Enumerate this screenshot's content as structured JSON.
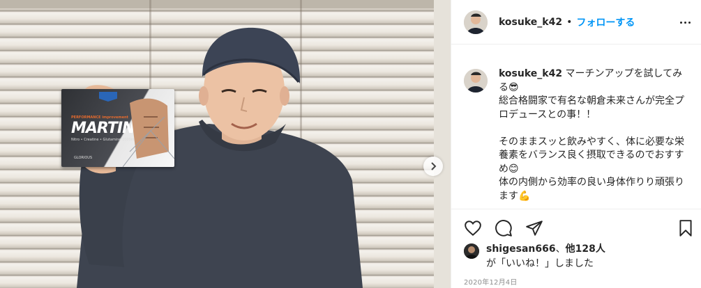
{
  "post": {
    "username": "kosuke_k42",
    "follow_label": "フォローする",
    "separator": "•",
    "caption_username": "kosuke_k42",
    "caption_text": " マーチンアップを試してみる😎\n総合格闘家で有名な朝倉未来さんが完全プロデュースとの事！！\n\nそのままスッと飲みやすく、体に必要な栄養素をバランス良く摂取できるのでおすすめ😊\n体の内側から効率の良い身体作りり頑張ります💪",
    "liked_by_user": "shigesan666",
    "liked_by_sep": "、",
    "liked_by_others": "他128人",
    "liked_by_suffix": "が「いいね！」しました",
    "date": "2020年12月4日"
  },
  "product": {
    "logo": "MARTIN-UP",
    "tagline": "PERFORMANCE improvement",
    "desc": "Nitro • Creatine • Glutamine 2000mg",
    "brand": "GLORIOUS"
  },
  "icons": {
    "like": "heart-icon",
    "comment": "comment-icon",
    "share": "share-icon",
    "save": "bookmark-icon",
    "more": "more-options-icon",
    "next": "chevron-right-icon"
  },
  "colors": {
    "link_blue": "#0095f6",
    "text": "#262626",
    "muted": "#8e8e8e"
  }
}
